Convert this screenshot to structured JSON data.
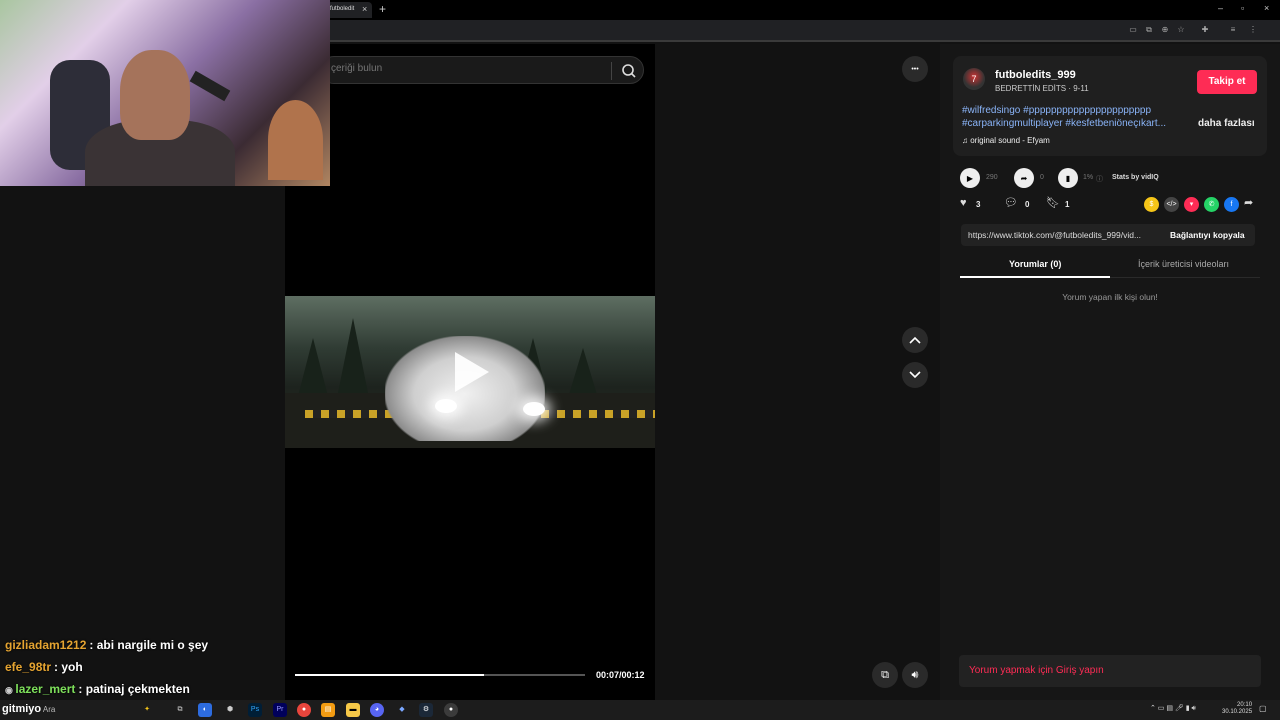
{
  "browser": {
    "tab_title": "futboledit",
    "tab_close": "×",
    "new_tab": "+",
    "window_controls": [
      "–",
      "▫",
      "×"
    ]
  },
  "search": {
    "placeholder": "çeriği bulun"
  },
  "video": {
    "current_time": "00:07/00:12",
    "progress_fraction": 0.652,
    "more_label": "•••"
  },
  "author": {
    "username": "futboledits_999",
    "subtitle": "BEDRETTİN EDİTS · 9-11",
    "avatar_text": "7",
    "follow_label": "Takip et",
    "description_line1": "#wilfredsingo #pppppppppppppppppppppp",
    "description_line2": "#carparkingmultiplayer #kesfetbeniöneçıkart...",
    "more_label": "daha fazlası",
    "sound": "original sound - Efyam"
  },
  "stats": {
    "plays": "290",
    "shares": "0",
    "ratio": "1%",
    "vidiq": "Stats by vidIQ"
  },
  "actions": {
    "likes": "3",
    "comments": "0",
    "saves": "1"
  },
  "share": {
    "link": "https://www.tiktok.com/@futboledits_999/vid...",
    "copy_label": "Bağlantıyı kopyala",
    "colors": {
      "coin": "#f5c518",
      "embed": "#444444",
      "tiktok": "#fe2c55",
      "whatsapp": "#25d366",
      "facebook": "#1877f2"
    }
  },
  "tabs": {
    "comments": "Yorumlar (0)",
    "creator_videos": "İçerik üreticisi videoları"
  },
  "comments": {
    "empty": "Yorum yapan ilk kişi olun!",
    "login_prompt": "Yorum yapmak için Giriş yapın"
  },
  "chat": [
    {
      "user": "gizliadam1212",
      "message": ": abi nargile mi o şey",
      "color": "#e5a431"
    },
    {
      "user": "efe_98tr",
      "message": ": yoh",
      "color": "#e5a431"
    },
    {
      "user": "lazer_mert",
      "message": ": patinaj çekmekten",
      "color": "#7ee05b"
    },
    {
      "user": "",
      "message": "gitmiyo",
      "color": "#ffffff"
    }
  ],
  "taskbar": {
    "search_label": "Ara",
    "time": "20:10",
    "date": "30.10.2025"
  }
}
